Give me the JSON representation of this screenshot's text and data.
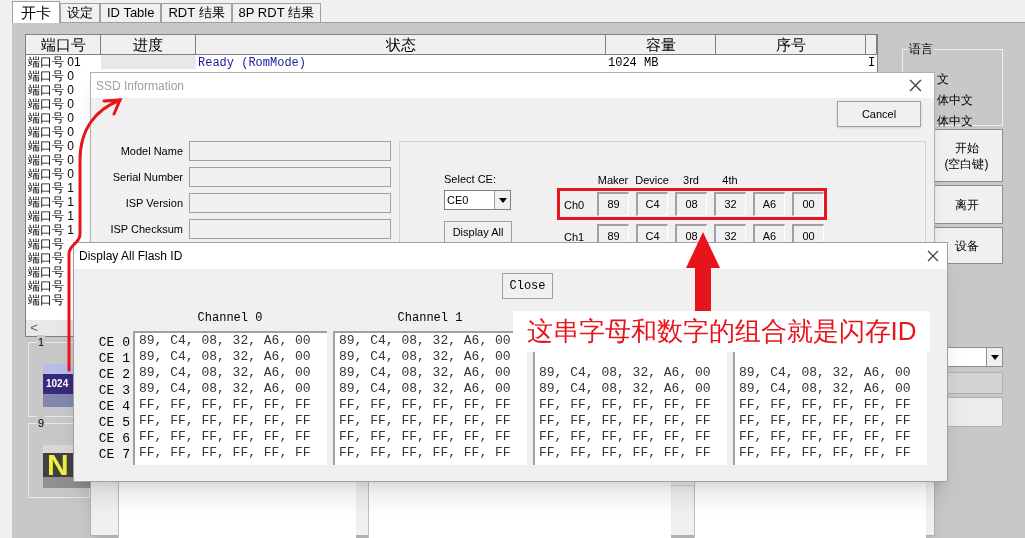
{
  "main_tabs": [
    {
      "label": "开卡",
      "selected": true
    },
    {
      "label": "设定",
      "selected": false
    },
    {
      "label": "ID Table",
      "selected": false
    },
    {
      "label": "RDT 结果",
      "selected": false
    },
    {
      "label": "8P RDT 结果",
      "selected": false
    }
  ],
  "port_table": {
    "columns": [
      "端口号",
      "进度",
      "状态",
      "容量",
      "序号"
    ],
    "rows": [
      {
        "port": "端口号 01",
        "status": "Ready (RomMode)",
        "capacity": "1024 MB",
        "column_6": "I"
      },
      {
        "port": "端口号 0"
      },
      {
        "port": "端口号 0"
      },
      {
        "port": "端口号 0"
      },
      {
        "port": "端口号 0"
      },
      {
        "port": "端口号 0"
      },
      {
        "port": "端口号 0"
      },
      {
        "port": "端口号 0"
      },
      {
        "port": "端口号 0"
      },
      {
        "port": "端口号 1"
      },
      {
        "port": "端口号 1"
      },
      {
        "port": "端口号 1"
      },
      {
        "port": "端口号 1"
      },
      {
        "port": "端口号"
      },
      {
        "port": "端口号"
      },
      {
        "port": "端口号"
      },
      {
        "port": "端口号"
      },
      {
        "port": "端口号"
      }
    ],
    "scroll_left": "<"
  },
  "port_groups": [
    {
      "label": "1",
      "kind": "text",
      "card_text": "1024"
    },
    {
      "label": "9",
      "kind": "letter",
      "card_text": "N"
    }
  ],
  "language_group": {
    "title": "语言",
    "options": [
      "文",
      "体中文",
      "体中文"
    ]
  },
  "side_buttons": [
    "开始\n(空白键)",
    "离开",
    "设备"
  ],
  "ssd_window": {
    "title": "SSD Information",
    "cancel": "Cancel",
    "fields": [
      "Model Name",
      "Serial Number",
      "ISP Version",
      "ISP Checksum"
    ],
    "select_ce_label": "Select CE:",
    "ce_value": "CE0",
    "display_all": "Display All",
    "id_headers": [
      "Maker",
      "Device",
      "3rd",
      "4th"
    ],
    "channels": [
      {
        "label": "Ch0",
        "bytes": [
          "89",
          "C4",
          "08",
          "32",
          "A6",
          "00"
        ],
        "highlighted": true
      },
      {
        "label": "Ch1",
        "bytes": [
          "89",
          "C4",
          "08",
          "32",
          "A6",
          "00"
        ],
        "highlighted": false
      }
    ]
  },
  "flash_dialog": {
    "title": "Display All Flash ID",
    "close_button": "Close",
    "row_labels": [
      "CE 0",
      "CE 1",
      "CE 2",
      "CE 3",
      "CE 4",
      "CE 5",
      "CE 6",
      "CE 7"
    ],
    "channels": [
      {
        "header": "Channel 0",
        "lines": [
          "89, C4, 08, 32, A6, 00",
          "89, C4, 08, 32, A6, 00",
          "89, C4, 08, 32, A6, 00",
          "89, C4, 08, 32, A6, 00",
          "FF, FF, FF, FF, FF, FF",
          "FF, FF, FF, FF, FF, FF",
          "FF, FF, FF, FF, FF, FF",
          "FF, FF, FF, FF, FF, FF"
        ]
      },
      {
        "header": "Channel 1",
        "lines": [
          "89, C4, 08, 32, A6, 00",
          "89, C4, 08, 32, A6, 00",
          "89, C4, 08, 32, A6, 00",
          "89, C4, 08, 32, A6, 00",
          "FF, FF, FF, FF, FF, FF",
          "FF, FF, FF, FF, FF, FF",
          "FF, FF, FF, FF, FF, FF",
          "FF, FF, FF, FF, FF, FF"
        ]
      },
      {
        "lines": [
          "89, C4, 08, 32, A6, 00",
          "89, C4, 08, 32, A6, 00",
          "FF, FF, FF, FF, FF, FF",
          "FF, FF, FF, FF, FF, FF",
          "FF, FF, FF, FF, FF, FF",
          "FF, FF, FF, FF, FF, FF"
        ]
      },
      {
        "lines": [
          "89, C4, 08, 32, A6, 00",
          "89, C4, 08, 32, A6, 00",
          "FF, FF, FF, FF, FF, FF",
          "FF, FF, FF, FF, FF, FF",
          "FF, FF, FF, FF, FF, FF",
          "FF, FF, FF, FF, FF, FF"
        ]
      }
    ]
  },
  "annotation": {
    "text": "这串字母和数字的组合就是闪存ID"
  }
}
